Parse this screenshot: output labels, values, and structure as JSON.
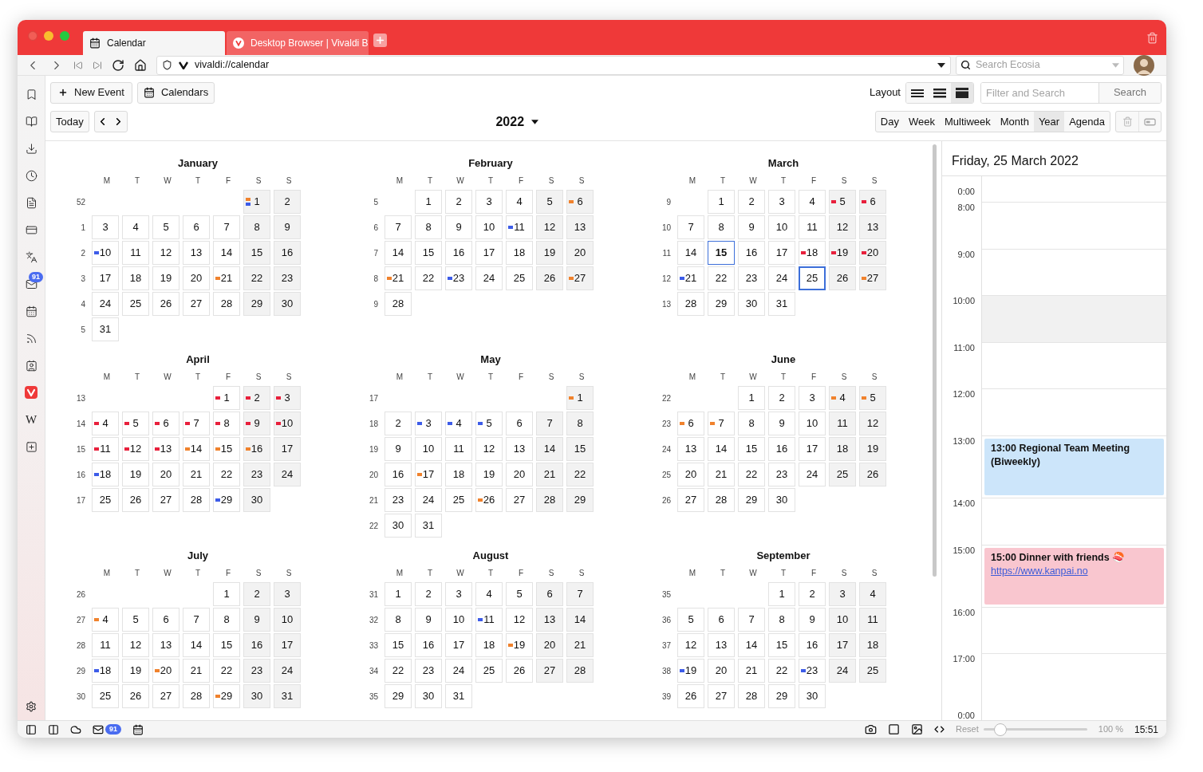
{
  "tabs": [
    {
      "title": "Calendar",
      "kind": "calendar",
      "selected": true
    },
    {
      "title": "Desktop Browser | Vivaldi B",
      "kind": "vivaldi",
      "selected": false
    }
  ],
  "address_bar": {
    "url": "vivaldi://calendar",
    "search_placeholder": "Search Ecosia"
  },
  "sidebar": {
    "items": [
      {
        "kind": "bookmark"
      },
      {
        "kind": "reading"
      },
      {
        "kind": "download"
      },
      {
        "kind": "history"
      },
      {
        "kind": "notes"
      },
      {
        "kind": "window"
      },
      {
        "kind": "translate"
      },
      {
        "kind": "mail",
        "badge": "91"
      },
      {
        "kind": "calendar"
      },
      {
        "kind": "feed"
      },
      {
        "kind": "contacts"
      },
      {
        "kind": "vivaldi"
      },
      {
        "kind": "letter",
        "label": "W"
      },
      {
        "kind": "add"
      }
    ]
  },
  "toolbar": {
    "new_event": "New Event",
    "calendars": "Calendars",
    "today": "Today",
    "year": "2022",
    "layout_label": "Layout",
    "layouts": [
      {
        "kind": "thin",
        "selected": false
      },
      {
        "kind": "medium",
        "selected": false
      },
      {
        "kind": "thick",
        "selected": true
      }
    ],
    "filter_placeholder": "Filter and Search",
    "search": "Search",
    "views": [
      {
        "label": "Day",
        "selected": false
      },
      {
        "label": "Week",
        "selected": false
      },
      {
        "label": "Multiweek",
        "selected": false
      },
      {
        "label": "Month",
        "selected": false
      },
      {
        "label": "Year",
        "selected": true
      },
      {
        "label": "Agenda",
        "selected": false
      }
    ]
  },
  "months": [
    {
      "name": "January",
      "weekdays": [
        "M",
        "T",
        "W",
        "T",
        "F",
        "S",
        "S"
      ],
      "weeks": [
        {
          "num": "52",
          "kind": "lead",
          "days": [
            {
              "day": "1",
              "selected": false,
              "marks": [
                {
                  "color": "#f0822d"
                },
                {
                  "color": "#3d5ce8"
                }
              ]
            },
            {
              "day": "2",
              "selected": false
            }
          ]
        },
        {
          "num": "1",
          "kind": "full",
          "days": [
            {
              "day": "3",
              "selected": false
            },
            {
              "day": "4",
              "selected": false
            },
            {
              "day": "5",
              "selected": false
            },
            {
              "day": "6",
              "selected": false
            },
            {
              "day": "7",
              "selected": false
            },
            {
              "day": "8",
              "selected": false
            },
            {
              "day": "9",
              "selected": false
            }
          ]
        },
        {
          "num": "2",
          "kind": "full",
          "days": [
            {
              "day": "10",
              "selected": false,
              "marks": [
                {
                  "color": "#3d5ce8"
                }
              ]
            },
            {
              "day": "11",
              "selected": false
            },
            {
              "day": "12",
              "selected": false
            },
            {
              "day": "13",
              "selected": false
            },
            {
              "day": "14",
              "selected": false
            },
            {
              "day": "15",
              "selected": false
            },
            {
              "day": "16",
              "selected": false
            }
          ]
        },
        {
          "num": "3",
          "kind": "full",
          "days": [
            {
              "day": "17",
              "selected": false
            },
            {
              "day": "18",
              "selected": false
            },
            {
              "day": "19",
              "selected": false
            },
            {
              "day": "20",
              "selected": false
            },
            {
              "day": "21",
              "selected": false,
              "marks": [
                {
                  "color": "#f0822d"
                }
              ]
            },
            {
              "day": "22",
              "selected": false
            },
            {
              "day": "23",
              "selected": false
            }
          ]
        },
        {
          "num": "4",
          "kind": "full",
          "days": [
            {
              "day": "24",
              "selected": false
            },
            {
              "day": "25",
              "selected": false
            },
            {
              "day": "26",
              "selected": false
            },
            {
              "day": "27",
              "selected": false
            },
            {
              "day": "28",
              "selected": false
            },
            {
              "day": "29",
              "selected": false
            },
            {
              "day": "30",
              "selected": false
            }
          ]
        },
        {
          "num": "5",
          "kind": "tail",
          "days": [
            {
              "day": "31",
              "selected": false
            }
          ]
        }
      ]
    },
    {
      "name": "February",
      "weekdays": [
        "M",
        "T",
        "W",
        "T",
        "F",
        "S",
        "S"
      ],
      "weeks": [
        {
          "num": "5",
          "kind": "lead",
          "days": [
            {
              "day": "1",
              "selected": false
            },
            {
              "day": "2",
              "selected": false
            },
            {
              "day": "3",
              "selected": false
            },
            {
              "day": "4",
              "selected": false
            },
            {
              "day": "5",
              "selected": false
            },
            {
              "day": "6",
              "selected": false,
              "marks": [
                {
                  "color": "#f0822d"
                }
              ]
            }
          ]
        },
        {
          "num": "6",
          "kind": "full",
          "days": [
            {
              "day": "7",
              "selected": false
            },
            {
              "day": "8",
              "selected": false
            },
            {
              "day": "9",
              "selected": false
            },
            {
              "day": "10",
              "selected": false
            },
            {
              "day": "11",
              "selected": false,
              "marks": [
                {
                  "color": "#3d5ce8"
                }
              ]
            },
            {
              "day": "12",
              "selected": false
            },
            {
              "day": "13",
              "selected": false
            }
          ]
        },
        {
          "num": "7",
          "kind": "full",
          "days": [
            {
              "day": "14",
              "selected": false
            },
            {
              "day": "15",
              "selected": false
            },
            {
              "day": "16",
              "selected": false
            },
            {
              "day": "17",
              "selected": false
            },
            {
              "day": "18",
              "selected": false
            },
            {
              "day": "19",
              "selected": false
            },
            {
              "day": "20",
              "selected": false
            }
          ]
        },
        {
          "num": "8",
          "kind": "full",
          "days": [
            {
              "day": "21",
              "selected": false,
              "marks": [
                {
                  "color": "#f0822d"
                }
              ]
            },
            {
              "day": "22",
              "selected": false
            },
            {
              "day": "23",
              "selected": false,
              "marks": [
                {
                  "color": "#3d5ce8"
                }
              ]
            },
            {
              "day": "24",
              "selected": false
            },
            {
              "day": "25",
              "selected": false
            },
            {
              "day": "26",
              "selected": false
            },
            {
              "day": "27",
              "selected": false,
              "marks": [
                {
                  "color": "#f0822d"
                }
              ]
            }
          ]
        },
        {
          "num": "9",
          "kind": "tail",
          "days": [
            {
              "day": "28",
              "selected": false
            }
          ]
        }
      ]
    },
    {
      "name": "March",
      "weekdays": [
        "M",
        "T",
        "W",
        "T",
        "F",
        "S",
        "S"
      ],
      "weeks": [
        {
          "num": "9",
          "kind": "lead",
          "days": [
            {
              "day": "1",
              "selected": false
            },
            {
              "day": "2",
              "selected": false
            },
            {
              "day": "3",
              "selected": false
            },
            {
              "day": "4",
              "selected": false
            },
            {
              "day": "5",
              "selected": false,
              "marks": [
                {
                  "color": "#e8203c"
                }
              ]
            },
            {
              "day": "6",
              "selected": false,
              "marks": [
                {
                  "color": "#e8203c"
                }
              ]
            }
          ]
        },
        {
          "num": "10",
          "kind": "full",
          "days": [
            {
              "day": "7",
              "selected": false
            },
            {
              "day": "8",
              "selected": false
            },
            {
              "day": "9",
              "selected": false
            },
            {
              "day": "10",
              "selected": false
            },
            {
              "day": "11",
              "selected": false
            },
            {
              "day": "12",
              "selected": false
            },
            {
              "day": "13",
              "selected": false
            }
          ]
        },
        {
          "num": "11",
          "kind": "full",
          "days": [
            {
              "day": "14",
              "selected": false
            },
            {
              "day": "15",
              "selected": false,
              "today": true
            },
            {
              "day": "16",
              "selected": false
            },
            {
              "day": "17",
              "selected": false
            },
            {
              "day": "18",
              "selected": false,
              "marks": [
                {
                  "color": "#e8203c"
                }
              ]
            },
            {
              "day": "19",
              "selected": false,
              "marks": [
                {
                  "color": "#e8203c"
                }
              ]
            },
            {
              "day": "20",
              "selected": false,
              "marks": [
                {
                  "color": "#e8203c"
                }
              ]
            }
          ]
        },
        {
          "num": "12",
          "kind": "full",
          "days": [
            {
              "day": "21",
              "selected": false,
              "marks": [
                {
                  "color": "#3d5ce8"
                }
              ]
            },
            {
              "day": "22",
              "selected": false
            },
            {
              "day": "23",
              "selected": false
            },
            {
              "day": "24",
              "selected": false
            },
            {
              "day": "25",
              "selected": true
            },
            {
              "day": "26",
              "selected": false
            },
            {
              "day": "27",
              "selected": false,
              "marks": [
                {
                  "color": "#f0822d"
                }
              ]
            }
          ]
        },
        {
          "num": "13",
          "kind": "tail",
          "days": [
            {
              "day": "28",
              "selected": false
            },
            {
              "day": "29",
              "selected": false
            },
            {
              "day": "30",
              "selected": false
            },
            {
              "day": "31",
              "selected": false
            }
          ]
        }
      ]
    },
    {
      "name": "April",
      "weekdays": [
        "M",
        "T",
        "W",
        "T",
        "F",
        "S",
        "S"
      ],
      "weeks": [
        {
          "num": "13",
          "kind": "lead",
          "days": [
            {
              "day": "1",
              "selected": false,
              "marks": [
                {
                  "color": "#e8203c"
                }
              ]
            },
            {
              "day": "2",
              "selected": false,
              "marks": [
                {
                  "color": "#e8203c"
                }
              ]
            },
            {
              "day": "3",
              "selected": false,
              "marks": [
                {
                  "color": "#e8203c"
                }
              ]
            }
          ]
        },
        {
          "num": "14",
          "kind": "full",
          "days": [
            {
              "day": "4",
              "selected": false,
              "marks": [
                {
                  "color": "#e8203c"
                }
              ]
            },
            {
              "day": "5",
              "selected": false,
              "marks": [
                {
                  "color": "#e8203c"
                }
              ]
            },
            {
              "day": "6",
              "selected": false,
              "marks": [
                {
                  "color": "#e8203c"
                }
              ]
            },
            {
              "day": "7",
              "selected": false,
              "marks": [
                {
                  "color": "#e8203c"
                }
              ]
            },
            {
              "day": "8",
              "selected": false,
              "marks": [
                {
                  "color": "#e8203c"
                }
              ]
            },
            {
              "day": "9",
              "selected": false,
              "marks": [
                {
                  "color": "#e8203c"
                }
              ]
            },
            {
              "day": "10",
              "selected": false,
              "marks": [
                {
                  "color": "#e8203c"
                }
              ]
            }
          ]
        },
        {
          "num": "15",
          "kind": "full",
          "days": [
            {
              "day": "11",
              "selected": false,
              "marks": [
                {
                  "color": "#e8203c"
                }
              ]
            },
            {
              "day": "12",
              "selected": false,
              "marks": [
                {
                  "color": "#e8203c"
                }
              ]
            },
            {
              "day": "13",
              "selected": false,
              "marks": [
                {
                  "color": "#e8203c"
                }
              ]
            },
            {
              "day": "14",
              "selected": false,
              "marks": [
                {
                  "color": "#f0822d"
                }
              ]
            },
            {
              "day": "15",
              "selected": false,
              "marks": [
                {
                  "color": "#f0822d"
                }
              ]
            },
            {
              "day": "16",
              "selected": false,
              "marks": [
                {
                  "color": "#f0822d"
                }
              ]
            },
            {
              "day": "17",
              "selected": false
            }
          ]
        },
        {
          "num": "16",
          "kind": "full",
          "days": [
            {
              "day": "18",
              "selected": false,
              "marks": [
                {
                  "color": "#3d5ce8"
                }
              ]
            },
            {
              "day": "19",
              "selected": false
            },
            {
              "day": "20",
              "selected": false
            },
            {
              "day": "21",
              "selected": false
            },
            {
              "day": "22",
              "selected": false
            },
            {
              "day": "23",
              "selected": false
            },
            {
              "day": "24",
              "selected": false
            }
          ]
        },
        {
          "num": "17",
          "kind": "tail",
          "days": [
            {
              "day": "25",
              "selected": false
            },
            {
              "day": "26",
              "selected": false
            },
            {
              "day": "27",
              "selected": false
            },
            {
              "day": "28",
              "selected": false
            },
            {
              "day": "29",
              "selected": false,
              "marks": [
                {
                  "color": "#3d5ce8"
                }
              ]
            },
            {
              "day": "30",
              "selected": false
            }
          ]
        }
      ]
    },
    {
      "name": "May",
      "weekdays": [
        "M",
        "T",
        "W",
        "T",
        "F",
        "S",
        "S"
      ],
      "weeks": [
        {
          "num": "17",
          "kind": "lead",
          "days": [
            {
              "day": "1",
              "selected": false,
              "marks": [
                {
                  "color": "#f0822d"
                }
              ]
            }
          ]
        },
        {
          "num": "18",
          "kind": "full",
          "days": [
            {
              "day": "2",
              "selected": false
            },
            {
              "day": "3",
              "selected": false,
              "marks": [
                {
                  "color": "#3d5ce8"
                }
              ]
            },
            {
              "day": "4",
              "selected": false,
              "marks": [
                {
                  "color": "#3d5ce8"
                }
              ]
            },
            {
              "day": "5",
              "selected": false,
              "marks": [
                {
                  "color": "#3d5ce8"
                }
              ]
            },
            {
              "day": "6",
              "selected": false
            },
            {
              "day": "7",
              "selected": false
            },
            {
              "day": "8",
              "selected": false
            }
          ]
        },
        {
          "num": "19",
          "kind": "full",
          "days": [
            {
              "day": "9",
              "selected": false
            },
            {
              "day": "10",
              "selected": false
            },
            {
              "day": "11",
              "selected": false
            },
            {
              "day": "12",
              "selected": false
            },
            {
              "day": "13",
              "selected": false
            },
            {
              "day": "14",
              "selected": false
            },
            {
              "day": "15",
              "selected": false
            }
          ]
        },
        {
          "num": "20",
          "kind": "full",
          "days": [
            {
              "day": "16",
              "selected": false
            },
            {
              "day": "17",
              "selected": false,
              "marks": [
                {
                  "color": "#f0822d"
                }
              ]
            },
            {
              "day": "18",
              "selected": false
            },
            {
              "day": "19",
              "selected": false
            },
            {
              "day": "20",
              "selected": false
            },
            {
              "day": "21",
              "selected": false
            },
            {
              "day": "22",
              "selected": false
            }
          ]
        },
        {
          "num": "21",
          "kind": "full",
          "days": [
            {
              "day": "23",
              "selected": false
            },
            {
              "day": "24",
              "selected": false
            },
            {
              "day": "25",
              "selected": false
            },
            {
              "day": "26",
              "selected": false,
              "marks": [
                {
                  "color": "#f0822d"
                }
              ]
            },
            {
              "day": "27",
              "selected": false
            },
            {
              "day": "28",
              "selected": false
            },
            {
              "day": "29",
              "selected": false
            }
          ]
        },
        {
          "num": "22",
          "kind": "tail",
          "days": [
            {
              "day": "30",
              "selected": false
            },
            {
              "day": "31",
              "selected": false
            }
          ]
        }
      ]
    },
    {
      "name": "June",
      "weekdays": [
        "M",
        "T",
        "W",
        "T",
        "F",
        "S",
        "S"
      ],
      "weeks": [
        {
          "num": "22",
          "kind": "lead",
          "days": [
            {
              "day": "1",
              "selected": false
            },
            {
              "day": "2",
              "selected": false
            },
            {
              "day": "3",
              "selected": false
            },
            {
              "day": "4",
              "selected": false,
              "marks": [
                {
                  "color": "#f0822d"
                }
              ]
            },
            {
              "day": "5",
              "selected": false,
              "marks": [
                {
                  "color": "#f0822d"
                }
              ]
            }
          ]
        },
        {
          "num": "23",
          "kind": "full",
          "days": [
            {
              "day": "6",
              "selected": false,
              "marks": [
                {
                  "color": "#f0822d"
                }
              ]
            },
            {
              "day": "7",
              "selected": false,
              "marks": [
                {
                  "color": "#f0822d"
                }
              ]
            },
            {
              "day": "8",
              "selected": false
            },
            {
              "day": "9",
              "selected": false
            },
            {
              "day": "10",
              "selected": false
            },
            {
              "day": "11",
              "selected": false
            },
            {
              "day": "12",
              "selected": false
            }
          ]
        },
        {
          "num": "24",
          "kind": "full",
          "days": [
            {
              "day": "13",
              "selected": false
            },
            {
              "day": "14",
              "selected": false
            },
            {
              "day": "15",
              "selected": false
            },
            {
              "day": "16",
              "selected": false
            },
            {
              "day": "17",
              "selected": false
            },
            {
              "day": "18",
              "selected": false
            },
            {
              "day": "19",
              "selected": false
            }
          ]
        },
        {
          "num": "25",
          "kind": "full",
          "days": [
            {
              "day": "20",
              "selected": false
            },
            {
              "day": "21",
              "selected": false
            },
            {
              "day": "22",
              "selected": false
            },
            {
              "day": "23",
              "selected": false
            },
            {
              "day": "24",
              "selected": false
            },
            {
              "day": "25",
              "selected": false
            },
            {
              "day": "26",
              "selected": false
            }
          ]
        },
        {
          "num": "26",
          "kind": "tail",
          "days": [
            {
              "day": "27",
              "selected": false
            },
            {
              "day": "28",
              "selected": false
            },
            {
              "day": "29",
              "selected": false
            },
            {
              "day": "30",
              "selected": false
            }
          ]
        }
      ]
    },
    {
      "name": "July",
      "weekdays": [
        "M",
        "T",
        "W",
        "T",
        "F",
        "S",
        "S"
      ],
      "weeks": [
        {
          "num": "26",
          "kind": "lead",
          "days": [
            {
              "day": "1",
              "selected": false
            },
            {
              "day": "2",
              "selected": false
            },
            {
              "day": "3",
              "selected": false
            }
          ]
        },
        {
          "num": "27",
          "kind": "full",
          "days": [
            {
              "day": "4",
              "selected": false,
              "marks": [
                {
                  "color": "#f0822d"
                }
              ]
            },
            {
              "day": "5",
              "selected": false
            },
            {
              "day": "6",
              "selected": false
            },
            {
              "day": "7",
              "selected": false
            },
            {
              "day": "8",
              "selected": false
            },
            {
              "day": "9",
              "selected": false
            },
            {
              "day": "10",
              "selected": false
            }
          ]
        },
        {
          "num": "28",
          "kind": "full",
          "days": [
            {
              "day": "11",
              "selected": false
            },
            {
              "day": "12",
              "selected": false
            },
            {
              "day": "13",
              "selected": false
            },
            {
              "day": "14",
              "selected": false
            },
            {
              "day": "15",
              "selected": false
            },
            {
              "day": "16",
              "selected": false
            },
            {
              "day": "17",
              "selected": false
            }
          ]
        },
        {
          "num": "29",
          "kind": "full",
          "days": [
            {
              "day": "18",
              "selected": false,
              "marks": [
                {
                  "color": "#3d5ce8"
                }
              ]
            },
            {
              "day": "19",
              "selected": false
            },
            {
              "day": "20",
              "selected": false,
              "marks": [
                {
                  "color": "#f0822d"
                }
              ]
            },
            {
              "day": "21",
              "selected": false
            },
            {
              "day": "22",
              "selected": false
            },
            {
              "day": "23",
              "selected": false
            },
            {
              "day": "24",
              "selected": false
            }
          ]
        },
        {
          "num": "30",
          "kind": "full",
          "days": [
            {
              "day": "25",
              "selected": false
            },
            {
              "day": "26",
              "selected": false
            },
            {
              "day": "27",
              "selected": false
            },
            {
              "day": "28",
              "selected": false
            },
            {
              "day": "29",
              "selected": false,
              "marks": [
                {
                  "color": "#f0822d"
                }
              ]
            },
            {
              "day": "30",
              "selected": false
            },
            {
              "day": "31",
              "selected": false
            }
          ]
        }
      ]
    },
    {
      "name": "August",
      "weekdays": [
        "M",
        "T",
        "W",
        "T",
        "F",
        "S",
        "S"
      ],
      "weeks": [
        {
          "num": "31",
          "kind": "full",
          "days": [
            {
              "day": "1",
              "selected": false
            },
            {
              "day": "2",
              "selected": false
            },
            {
              "day": "3",
              "selected": false
            },
            {
              "day": "4",
              "selected": false
            },
            {
              "day": "5",
              "selected": false
            },
            {
              "day": "6",
              "selected": false
            },
            {
              "day": "7",
              "selected": false
            }
          ]
        },
        {
          "num": "32",
          "kind": "full",
          "days": [
            {
              "day": "8",
              "selected": false
            },
            {
              "day": "9",
              "selected": false
            },
            {
              "day": "10",
              "selected": false
            },
            {
              "day": "11",
              "selected": false,
              "marks": [
                {
                  "color": "#3d5ce8"
                }
              ]
            },
            {
              "day": "12",
              "selected": false
            },
            {
              "day": "13",
              "selected": false
            },
            {
              "day": "14",
              "selected": false
            }
          ]
        },
        {
          "num": "33",
          "kind": "full",
          "days": [
            {
              "day": "15",
              "selected": false
            },
            {
              "day": "16",
              "selected": false
            },
            {
              "day": "17",
              "selected": false
            },
            {
              "day": "18",
              "selected": false
            },
            {
              "day": "19",
              "selected": false,
              "marks": [
                {
                  "color": "#f0822d"
                }
              ]
            },
            {
              "day": "20",
              "selected": false
            },
            {
              "day": "21",
              "selected": false
            }
          ]
        },
        {
          "num": "34",
          "kind": "full",
          "days": [
            {
              "day": "22",
              "selected": false
            },
            {
              "day": "23",
              "selected": false
            },
            {
              "day": "24",
              "selected": false
            },
            {
              "day": "25",
              "selected": false
            },
            {
              "day": "26",
              "selected": false
            },
            {
              "day": "27",
              "selected": false
            },
            {
              "day": "28",
              "selected": false
            }
          ]
        },
        {
          "num": "35",
          "kind": "tail",
          "days": [
            {
              "day": "29",
              "selected": false
            },
            {
              "day": "30",
              "selected": false
            },
            {
              "day": "31",
              "selected": false
            }
          ]
        }
      ]
    },
    {
      "name": "September",
      "weekdays": [
        "M",
        "T",
        "W",
        "T",
        "F",
        "S",
        "S"
      ],
      "weeks": [
        {
          "num": "35",
          "kind": "lead",
          "days": [
            {
              "day": "1",
              "selected": false
            },
            {
              "day": "2",
              "selected": false
            },
            {
              "day": "3",
              "selected": false
            },
            {
              "day": "4",
              "selected": false
            }
          ]
        },
        {
          "num": "36",
          "kind": "full",
          "days": [
            {
              "day": "5",
              "selected": false
            },
            {
              "day": "6",
              "selected": false
            },
            {
              "day": "7",
              "selected": false
            },
            {
              "day": "8",
              "selected": false
            },
            {
              "day": "9",
              "selected": false
            },
            {
              "day": "10",
              "selected": false
            },
            {
              "day": "11",
              "selected": false
            }
          ]
        },
        {
          "num": "37",
          "kind": "full",
          "days": [
            {
              "day": "12",
              "selected": false
            },
            {
              "day": "13",
              "selected": false
            },
            {
              "day": "14",
              "selected": false
            },
            {
              "day": "15",
              "selected": false
            },
            {
              "day": "16",
              "selected": false
            },
            {
              "day": "17",
              "selected": false
            },
            {
              "day": "18",
              "selected": false
            }
          ]
        },
        {
          "num": "38",
          "kind": "full",
          "days": [
            {
              "day": "19",
              "selected": false,
              "marks": [
                {
                  "color": "#3d5ce8"
                }
              ]
            },
            {
              "day": "20",
              "selected": false
            },
            {
              "day": "21",
              "selected": false
            },
            {
              "day": "22",
              "selected": false
            },
            {
              "day": "23",
              "selected": false,
              "marks": [
                {
                  "color": "#3d5ce8"
                }
              ]
            },
            {
              "day": "24",
              "selected": false
            },
            {
              "day": "25",
              "selected": false
            }
          ]
        },
        {
          "num": "39",
          "kind": "tail",
          "days": [
            {
              "day": "26",
              "selected": false
            },
            {
              "day": "27",
              "selected": false
            },
            {
              "day": "28",
              "selected": false
            },
            {
              "day": "29",
              "selected": false
            },
            {
              "day": "30",
              "selected": false
            }
          ]
        }
      ]
    }
  ],
  "day_panel": {
    "title": "Friday, 25 March 2022",
    "hours": [
      {
        "label": "0:00",
        "kind": "top"
      },
      {
        "label": "8:00",
        "kind": "hour"
      },
      {
        "label": "9:00",
        "kind": "hour"
      },
      {
        "label": "10:00",
        "kind": "shaded_hour"
      },
      {
        "label": "11:00",
        "kind": "hour"
      },
      {
        "label": "12:00",
        "kind": "hour"
      },
      {
        "label": "13:00",
        "kind": "hour",
        "event": {
          "title": "13:00 Regional Team Meeting (Biweekly)",
          "color": "#cce5fa"
        }
      },
      {
        "label": "14:00",
        "kind": "hour"
      },
      {
        "label": "15:00",
        "kind": "hour",
        "event": {
          "title": "15:00 Dinner with friends 🍣",
          "link": "https://www.kanpai.no",
          "color": "#f9c6cf"
        }
      },
      {
        "label": "16:00",
        "kind": "hour"
      },
      {
        "label": "17:00",
        "kind": "hour"
      },
      {
        "label": "0:00",
        "kind": "bottom"
      }
    ]
  },
  "status_bar": {
    "mail_badge": "91",
    "reset": "Reset",
    "zoom_slider": {
      "level": 0.1
    },
    "zoom": "100 %",
    "time": "15:51"
  }
}
